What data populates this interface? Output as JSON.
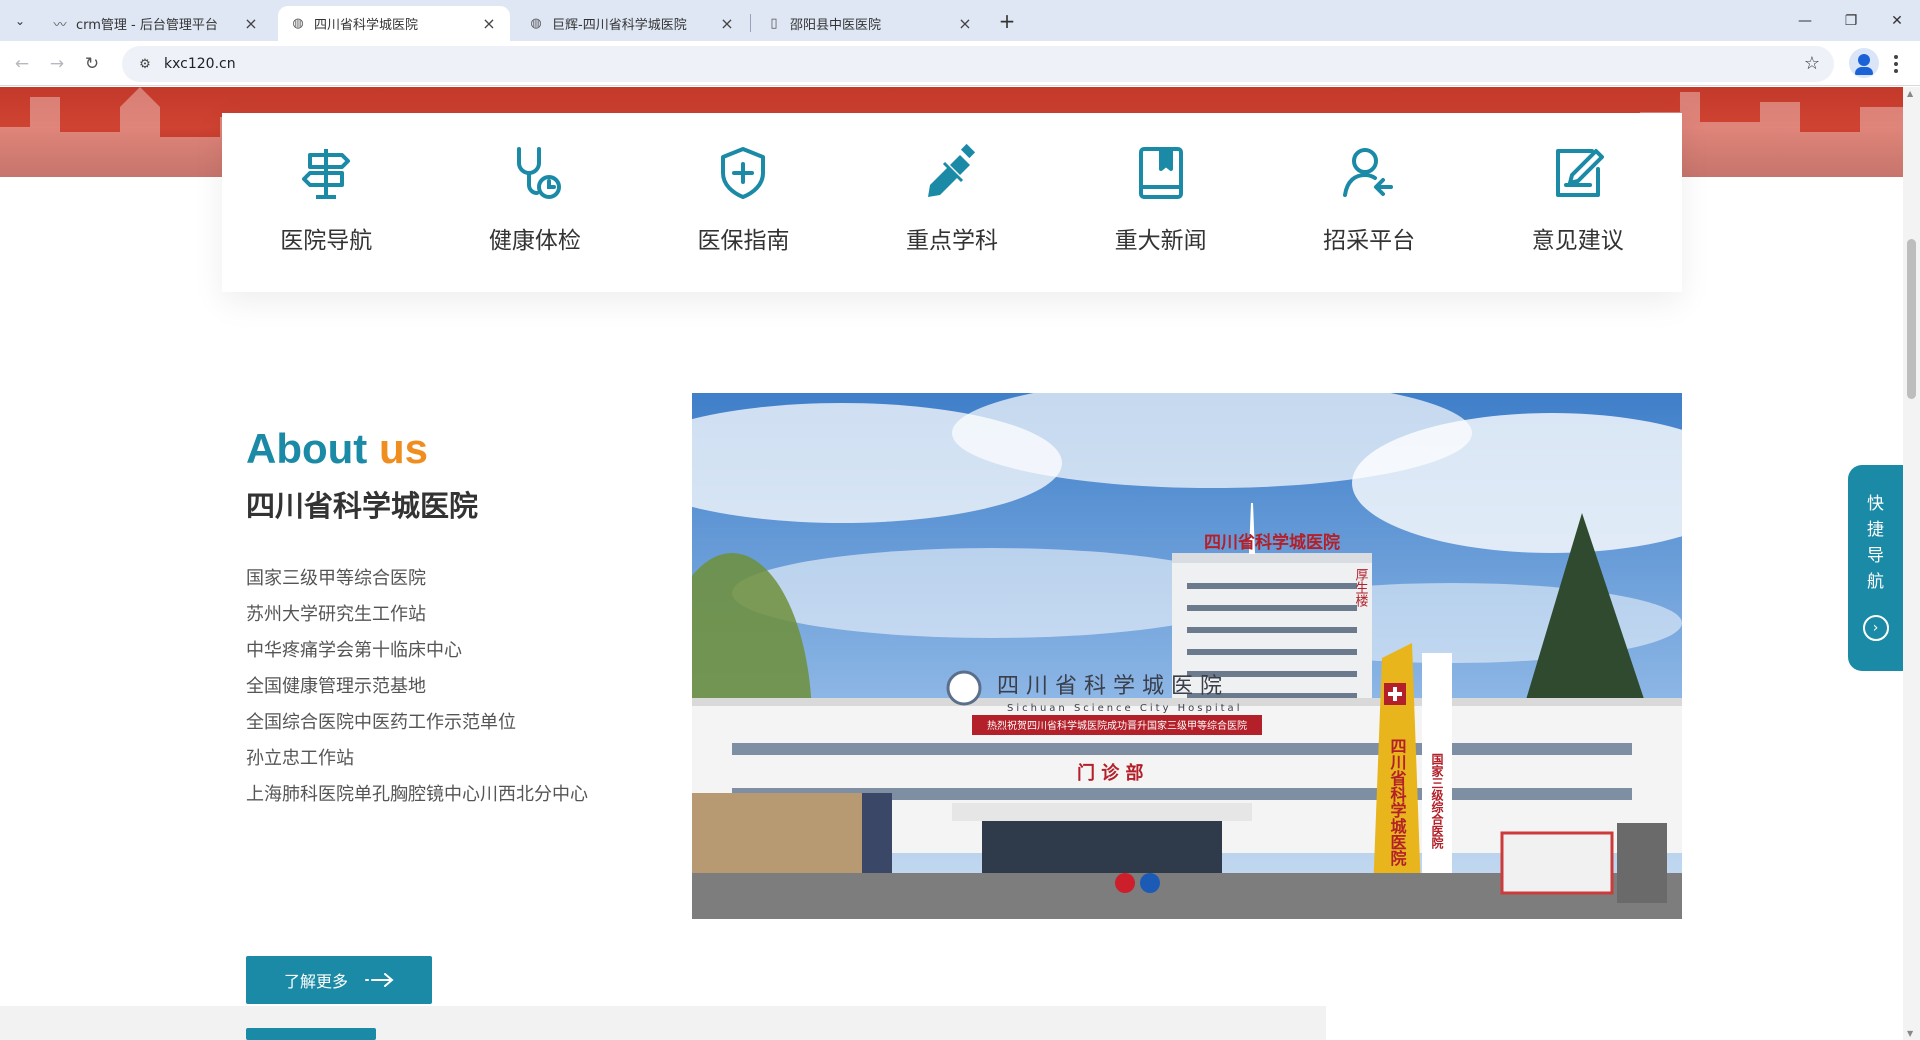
{
  "browser": {
    "tabs": [
      {
        "title": "crm管理 - 后台管理平台",
        "favicon": "crm-favicon"
      },
      {
        "title": "四川省科学城医院",
        "favicon": "globe-icon"
      },
      {
        "title": "巨辉-四川省科学城医院",
        "favicon": "globe-icon"
      },
      {
        "title": "邵阳县中医医院",
        "favicon": "doc-icon"
      }
    ],
    "active_tab_index": 1,
    "url": "kxc120.cn"
  },
  "quick_nav": [
    {
      "label": "医院导航",
      "icon": "signpost-icon"
    },
    {
      "label": "健康体检",
      "icon": "checkup-icon"
    },
    {
      "label": "医保指南",
      "icon": "shield-plus-icon"
    },
    {
      "label": "重点学科",
      "icon": "pencil-ruler-icon"
    },
    {
      "label": "重大新闻",
      "icon": "news-book-icon"
    },
    {
      "label": "招采平台",
      "icon": "user-arrow-icon"
    },
    {
      "label": "意见建议",
      "icon": "edit-note-icon"
    }
  ],
  "about": {
    "heading_word1": "About",
    "heading_word2": "us",
    "hospital_name": "四川省科学城医院",
    "credentials": [
      "国家三级甲等综合医院",
      "苏州大学研究生工作站",
      "中华疼痛学会第十临床中心",
      "全国健康管理示范基地",
      "全国综合医院中医药工作示范单位",
      "孙立忠工作站",
      "上海肺科医院单孔胸腔镜中心川西北分中心"
    ],
    "more_button": "了解更多"
  },
  "photo": {
    "roof_sign": "四川省科学城医院",
    "tower_label": "厚生楼",
    "facade_name": "四 川 省 科 学 城 医 院",
    "facade_english": "Sichuan Science City Hospital",
    "red_banner": "热烈祝贺四川省科学城医院成功晋升国家三级甲等综合医院",
    "entrance_sign": "门 诊 部",
    "pillar_text": "四川省科学城医院",
    "pillar_side": "国家三级综合医院"
  },
  "side_float": {
    "label": "快捷导航"
  },
  "colors": {
    "primary": "#1b8aa6",
    "accent": "#ef8e1f",
    "banner_red": "#c3392a"
  }
}
